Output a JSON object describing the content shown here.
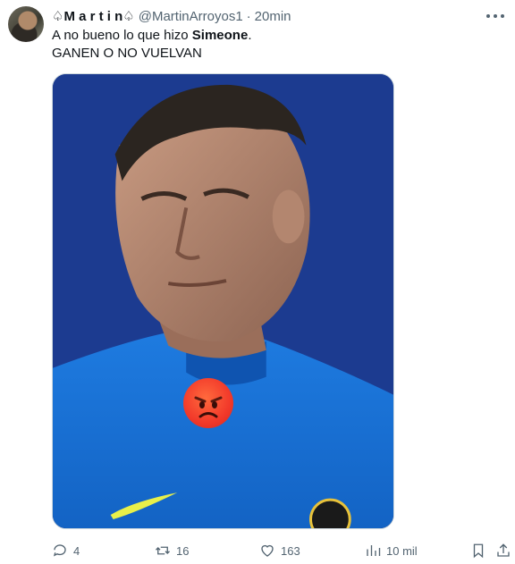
{
  "tweet": {
    "author_name": "♤M a r t i n♤",
    "handle": "@MartinArroyos1",
    "separator": "·",
    "time": "20min",
    "text_line1_pre": "A no bueno lo que hizo ",
    "text_line1_bold": "Simeone",
    "text_line1_post": ".",
    "text_line2": "GANEN O NO VUELVAN"
  },
  "actions": {
    "replies": "4",
    "retweets": "16",
    "likes": "163",
    "views": "10 mil"
  },
  "icons": {
    "more": "more-dots-icon",
    "reply": "reply-icon",
    "retweet": "retweet-icon",
    "like": "heart-icon",
    "views": "views-icon",
    "bookmark": "bookmark-icon",
    "share": "share-icon",
    "media_emoji": "angry-face-emoji"
  },
  "colors": {
    "text_primary": "#0f1419",
    "text_secondary": "#536471",
    "media_background": "#1b3a8f"
  }
}
